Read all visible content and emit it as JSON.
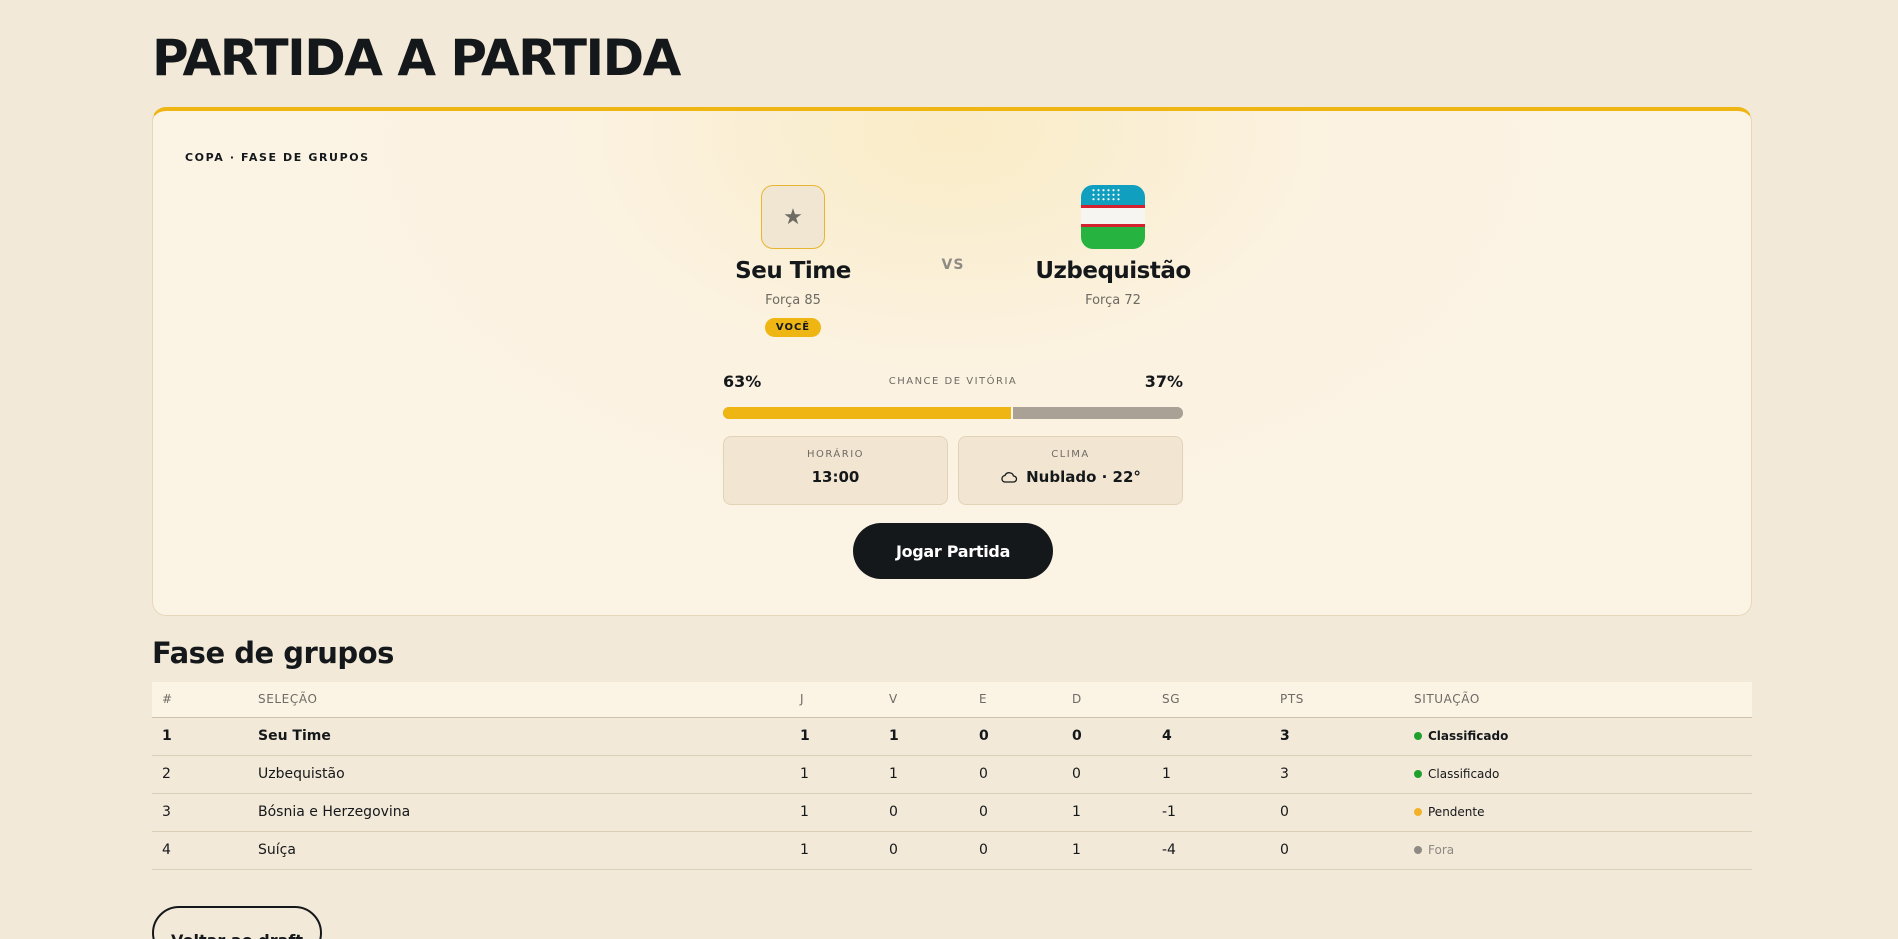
{
  "page": {
    "title": "PARTIDA A PARTIDA"
  },
  "match": {
    "stage": "COPA · FASE DE GRUPOS",
    "vs": "VS",
    "home": {
      "name": "Seu Time",
      "strength": "Força 85",
      "badge": "VOCÊ",
      "icon": "star-icon"
    },
    "away": {
      "name": "Uzbequistão",
      "strength": "Força 72",
      "icon": "uzbekistan-flag-icon"
    },
    "odds": {
      "label": "CHANCE DE VITÓRIA",
      "home_pct": "63%",
      "away_pct": "37%",
      "home_fraction": 0.63
    },
    "time": {
      "label": "HORÁRIO",
      "value": "13:00"
    },
    "weather": {
      "label": "CLIMA",
      "value": "Nublado · 22°",
      "icon": "cloud-icon"
    },
    "play_label": "Jogar Partida"
  },
  "colors": {
    "accent": "#efb512",
    "dark": "#15181b",
    "away_bar": "#aaa196",
    "qualified": "#1fa02c",
    "pending": "#f2b22c",
    "eliminated": "#8e8a84"
  },
  "group": {
    "title": "Fase de grupos",
    "columns": [
      "#",
      "SELEÇÃO",
      "J",
      "V",
      "E",
      "D",
      "SG",
      "PTS",
      "SITUAÇÃO"
    ],
    "rows": [
      {
        "pos": "1",
        "team": "Seu Time",
        "j": "1",
        "v": "1",
        "e": "0",
        "d": "0",
        "sg": "4",
        "pts": "3",
        "status": "Classificado",
        "status_color": "#1fa02c"
      },
      {
        "pos": "2",
        "team": "Uzbequistão",
        "j": "1",
        "v": "1",
        "e": "0",
        "d": "0",
        "sg": "1",
        "pts": "3",
        "status": "Classificado",
        "status_color": "#1fa02c"
      },
      {
        "pos": "3",
        "team": "Bósnia e Herzegovina",
        "j": "1",
        "v": "0",
        "e": "0",
        "d": "1",
        "sg": "-1",
        "pts": "0",
        "status": "Pendente",
        "status_color": "#f2b22c"
      },
      {
        "pos": "4",
        "team": "Suíça",
        "j": "1",
        "v": "0",
        "e": "0",
        "d": "1",
        "sg": "-4",
        "pts": "0",
        "status": "Fora",
        "status_color": "#8e8a84"
      }
    ]
  },
  "back_label": "Voltar ao draft"
}
